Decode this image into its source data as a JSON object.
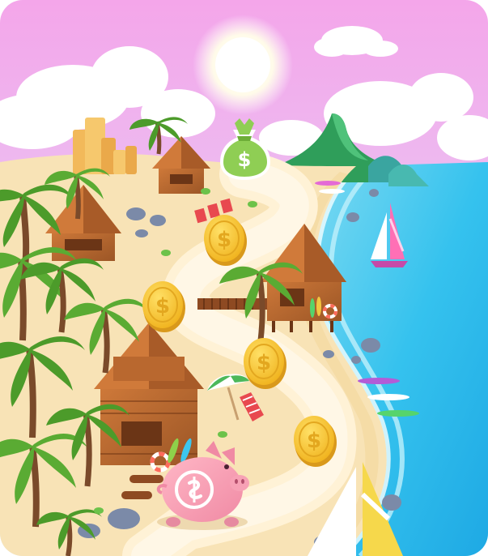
{
  "game": {
    "symbols": {
      "money_bag": "$",
      "coin": "$"
    },
    "icons": {
      "reward": "money-bag-icon",
      "coin": "dollar-coin-icon",
      "player": "piggy-bank-icon"
    },
    "colors": {
      "sky_top": "#f6a9ec",
      "sky_bottom": "#dff3fb",
      "sand": "#f8e3b6",
      "path": "#fff1d2",
      "ocean": "#3cc6ee",
      "coin": "#f6c22b",
      "bag": "#8fce54",
      "piggy": "#f7a1b5",
      "hut": "#b9682f",
      "palm": "#4c9b2a"
    }
  }
}
